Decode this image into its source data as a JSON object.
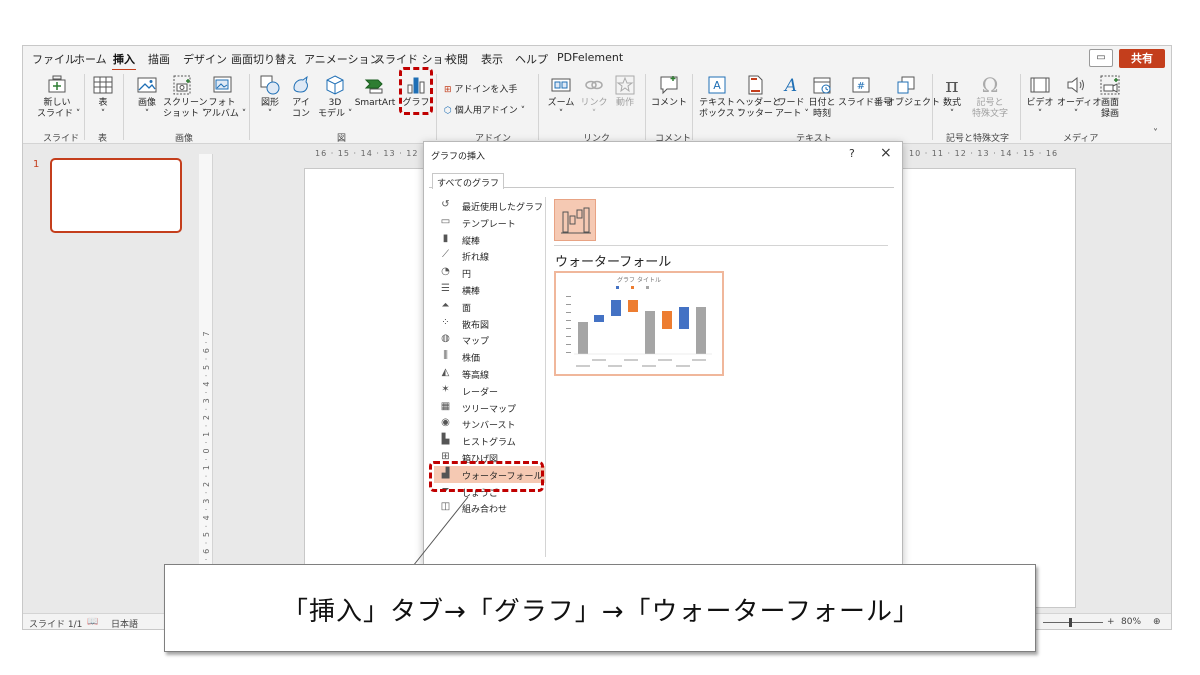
{
  "menu": {
    "tabs": [
      "ファイル",
      "ホーム",
      "挿入",
      "描画",
      "デザイン",
      "画面切り替え",
      "アニメーション",
      "スライド ショー",
      "校閲",
      "表示",
      "ヘルプ",
      "PDFelement"
    ],
    "active_tab": "挿入",
    "share_label": "共有",
    "accent_color": "#c43e1c"
  },
  "ribbon": {
    "buttons": {
      "new_slide": "新しい\nスライド ˅",
      "table": "表\n˅",
      "image": "画像\n˅",
      "screenshot": "スクリーン\nショット ˅",
      "photo_album": "フォト\nアルバム ˅",
      "shapes": "図形\n˅",
      "icons": "アイ\nコン",
      "model_3d": "3D\nモデル ˅",
      "smartart": "SmartArt",
      "chart": "グラフ",
      "get_addins": "アドインを入手",
      "my_addins": "個人用アドイン ˅",
      "zoom": "ズーム\n˅",
      "link": "リンク\n˅",
      "action": "動作",
      "comment": "コメント",
      "textbox": "テキスト\nボックス ˅",
      "header_footer": "ヘッダーと\nフッター",
      "wordart": "ワード\nアート ˅",
      "datetime": "日付と\n時刻",
      "slide_number": "スライド番号",
      "object": "オブジェクト",
      "equation": "数式\n˅",
      "symbol": "記号と\n特殊文字",
      "video": "ビデオ\n˅",
      "audio": "オーディオ\n˅",
      "screen_record": "画面\n録画"
    },
    "groups": {
      "slides": "スライド",
      "tables": "表",
      "images": "画像",
      "illustrations": "図",
      "addins": "アドイン",
      "links": "リンク",
      "comments": "コメント",
      "text": "テキスト",
      "symbols": "記号と特殊文字",
      "media": "メディア"
    }
  },
  "thumbnail": {
    "slide_number": "1"
  },
  "rulers": {
    "horizontal_left": "16 · 15 · 14 · 13 · 12",
    "horizontal_right": "10 · 11 · 12 · 13 · 14 · 15 · 16",
    "vertical": "9 · 8 · 7 · 6 · 5 · 4 · 3 · 2 · 1 · 0 · 1 · 2 · 3 · 4 · 5 · 6 · 7"
  },
  "status_bar": {
    "slide_info": "スライド 1/1",
    "language": "日本語",
    "zoom": "80%"
  },
  "dialog": {
    "title": "グラフの挿入",
    "help": "?",
    "close": "×",
    "tab": "すべてのグラフ",
    "categories": [
      {
        "icon": "recent-icon",
        "label": "最近使用したグラフ"
      },
      {
        "icon": "template-icon",
        "label": "テンプレート"
      },
      {
        "icon": "column-chart-icon",
        "label": "縦棒"
      },
      {
        "icon": "line-chart-icon",
        "label": "折れ線"
      },
      {
        "icon": "pie-chart-icon",
        "label": "円"
      },
      {
        "icon": "bar-chart-icon",
        "label": "横棒"
      },
      {
        "icon": "area-chart-icon",
        "label": "面"
      },
      {
        "icon": "scatter-chart-icon",
        "label": "散布図"
      },
      {
        "icon": "map-chart-icon",
        "label": "マップ"
      },
      {
        "icon": "stock-chart-icon",
        "label": "株価"
      },
      {
        "icon": "surface-chart-icon",
        "label": "等高線"
      },
      {
        "icon": "radar-chart-icon",
        "label": "レーダー"
      },
      {
        "icon": "treemap-chart-icon",
        "label": "ツリーマップ"
      },
      {
        "icon": "sunburst-chart-icon",
        "label": "サンバースト"
      },
      {
        "icon": "histogram-chart-icon",
        "label": "ヒストグラム"
      },
      {
        "icon": "boxwhisker-chart-icon",
        "label": "箱ひげ図"
      },
      {
        "icon": "waterfall-chart-icon",
        "label": "ウォーターフォール"
      },
      {
        "icon": "funnel-chart-icon",
        "label": "じょうご"
      },
      {
        "icon": "combo-chart-icon",
        "label": "組み合わせ"
      }
    ],
    "selected_category": "ウォーターフォール",
    "chart_type_name": "ウォーターフォール",
    "preview_title": "グラフ タイトル",
    "highlight_color": "#c00000"
  },
  "callout": {
    "text": "「挿入」タブ→「グラフ」→「ウォーターフォール」"
  }
}
